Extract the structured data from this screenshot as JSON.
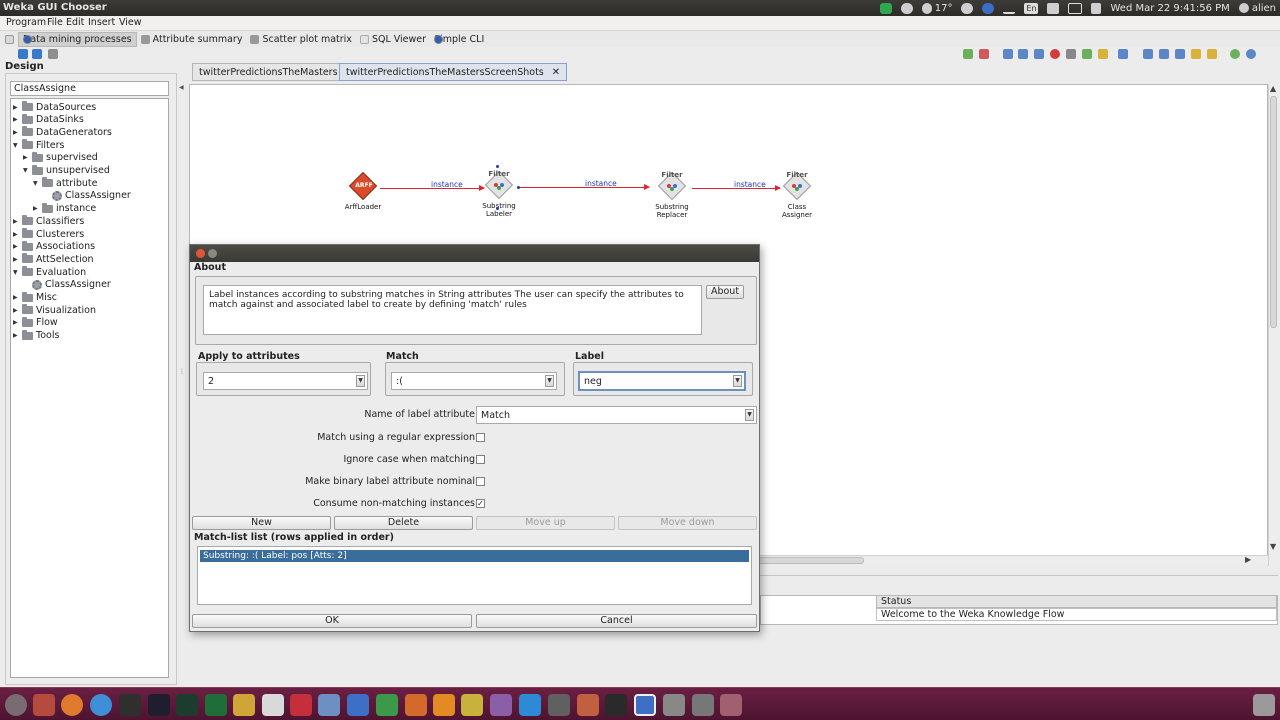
{
  "window": {
    "title": "Weka GUI Chooser"
  },
  "systray": {
    "temperature": "17°",
    "datetime": "Wed Mar 22  9:41:56 PM",
    "user": "alien",
    "lang": "En"
  },
  "menu": [
    "Program",
    "File",
    "Edit",
    "Insert",
    "View"
  ],
  "perspectives": [
    {
      "label": "Data mining processes",
      "selected": true
    },
    {
      "label": "Attribute summary"
    },
    {
      "label": "Scatter plot matrix"
    },
    {
      "label": "SQL Viewer"
    },
    {
      "label": "Simple CLI"
    }
  ],
  "design": {
    "heading": "Design",
    "search_value": "ClassAssigne",
    "tree": [
      {
        "label": "DataSources",
        "indent": 0,
        "type": "folder",
        "toggle": "▶"
      },
      {
        "label": "DataSinks",
        "indent": 0,
        "type": "folder",
        "toggle": "▶"
      },
      {
        "label": "DataGenerators",
        "indent": 0,
        "type": "folder",
        "toggle": "▶"
      },
      {
        "label": "Filters",
        "indent": 0,
        "type": "folder",
        "toggle": "▼"
      },
      {
        "label": "supervised",
        "indent": 1,
        "type": "folder",
        "toggle": "▶"
      },
      {
        "label": "unsupervised",
        "indent": 1,
        "type": "folder",
        "toggle": "▼"
      },
      {
        "label": "attribute",
        "indent": 2,
        "type": "folder",
        "toggle": "▼"
      },
      {
        "label": "ClassAssigner",
        "indent": 3,
        "type": "leaf",
        "toggle": ""
      },
      {
        "label": "instance",
        "indent": 2,
        "type": "folder",
        "toggle": "▶"
      },
      {
        "label": "Classifiers",
        "indent": 0,
        "type": "folder",
        "toggle": "▶"
      },
      {
        "label": "Clusterers",
        "indent": 0,
        "type": "folder",
        "toggle": "▶"
      },
      {
        "label": "Associations",
        "indent": 0,
        "type": "folder",
        "toggle": "▶"
      },
      {
        "label": "AttSelection",
        "indent": 0,
        "type": "folder",
        "toggle": "▶"
      },
      {
        "label": "Evaluation",
        "indent": 0,
        "type": "folder",
        "toggle": "▼"
      },
      {
        "label": "ClassAssigner",
        "indent": 1,
        "type": "leaf",
        "toggle": ""
      },
      {
        "label": "Misc",
        "indent": 0,
        "type": "folder",
        "toggle": "▶"
      },
      {
        "label": "Visualization",
        "indent": 0,
        "type": "folder",
        "toggle": "▶"
      },
      {
        "label": "Flow",
        "indent": 0,
        "type": "folder",
        "toggle": "▶"
      },
      {
        "label": "Tools",
        "indent": 0,
        "type": "folder",
        "toggle": "▶"
      }
    ]
  },
  "tabs": [
    {
      "label": "twitterPredictionsTheMasters",
      "active": false
    },
    {
      "label": "twitterPredictionsTheMastersScreenShots",
      "active": true
    }
  ],
  "flow": {
    "nodes": [
      {
        "name": "ArffLoader",
        "badge": "ARFF"
      },
      {
        "name": "Substring\nLabeler",
        "badge": "Filter"
      },
      {
        "name": "Substring\nReplacer",
        "badge": "Filter"
      },
      {
        "name": "Class\nAssigner",
        "badge": "Filter"
      }
    ],
    "connection_label": "instance"
  },
  "status": {
    "header": "Status",
    "message": "Welcome to the Weka Knowledge Flow"
  },
  "dialog": {
    "about_heading": "About",
    "about_text": "Label instances according to substring matches in String attributes The user can specify the attributes to match against and associated label to create by defining 'match' rules",
    "about_button": "About",
    "apply_label": "Apply to attributes",
    "apply_value": "2",
    "match_label": "Match",
    "match_value": ":(",
    "label_label": "Label",
    "label_value": "neg",
    "name_of_label_attribute_label": "Name of label attribute",
    "name_of_label_attribute_value": "Match",
    "regex_label": "Match using a regular expression",
    "ignore_case_label": "Ignore case when matching",
    "binary_label": "Make binary label attribute nominal",
    "consume_label": "Consume non-matching instances",
    "new_button": "New",
    "delete_button": "Delete",
    "moveup_button": "Move up",
    "movedown_button": "Move down",
    "matchlist_heading": "Match-list list (rows applied in order)",
    "matchlist_row": "Substring: :(    Label: pos  [Atts: 2]",
    "ok_button": "OK",
    "cancel_button": "Cancel"
  }
}
